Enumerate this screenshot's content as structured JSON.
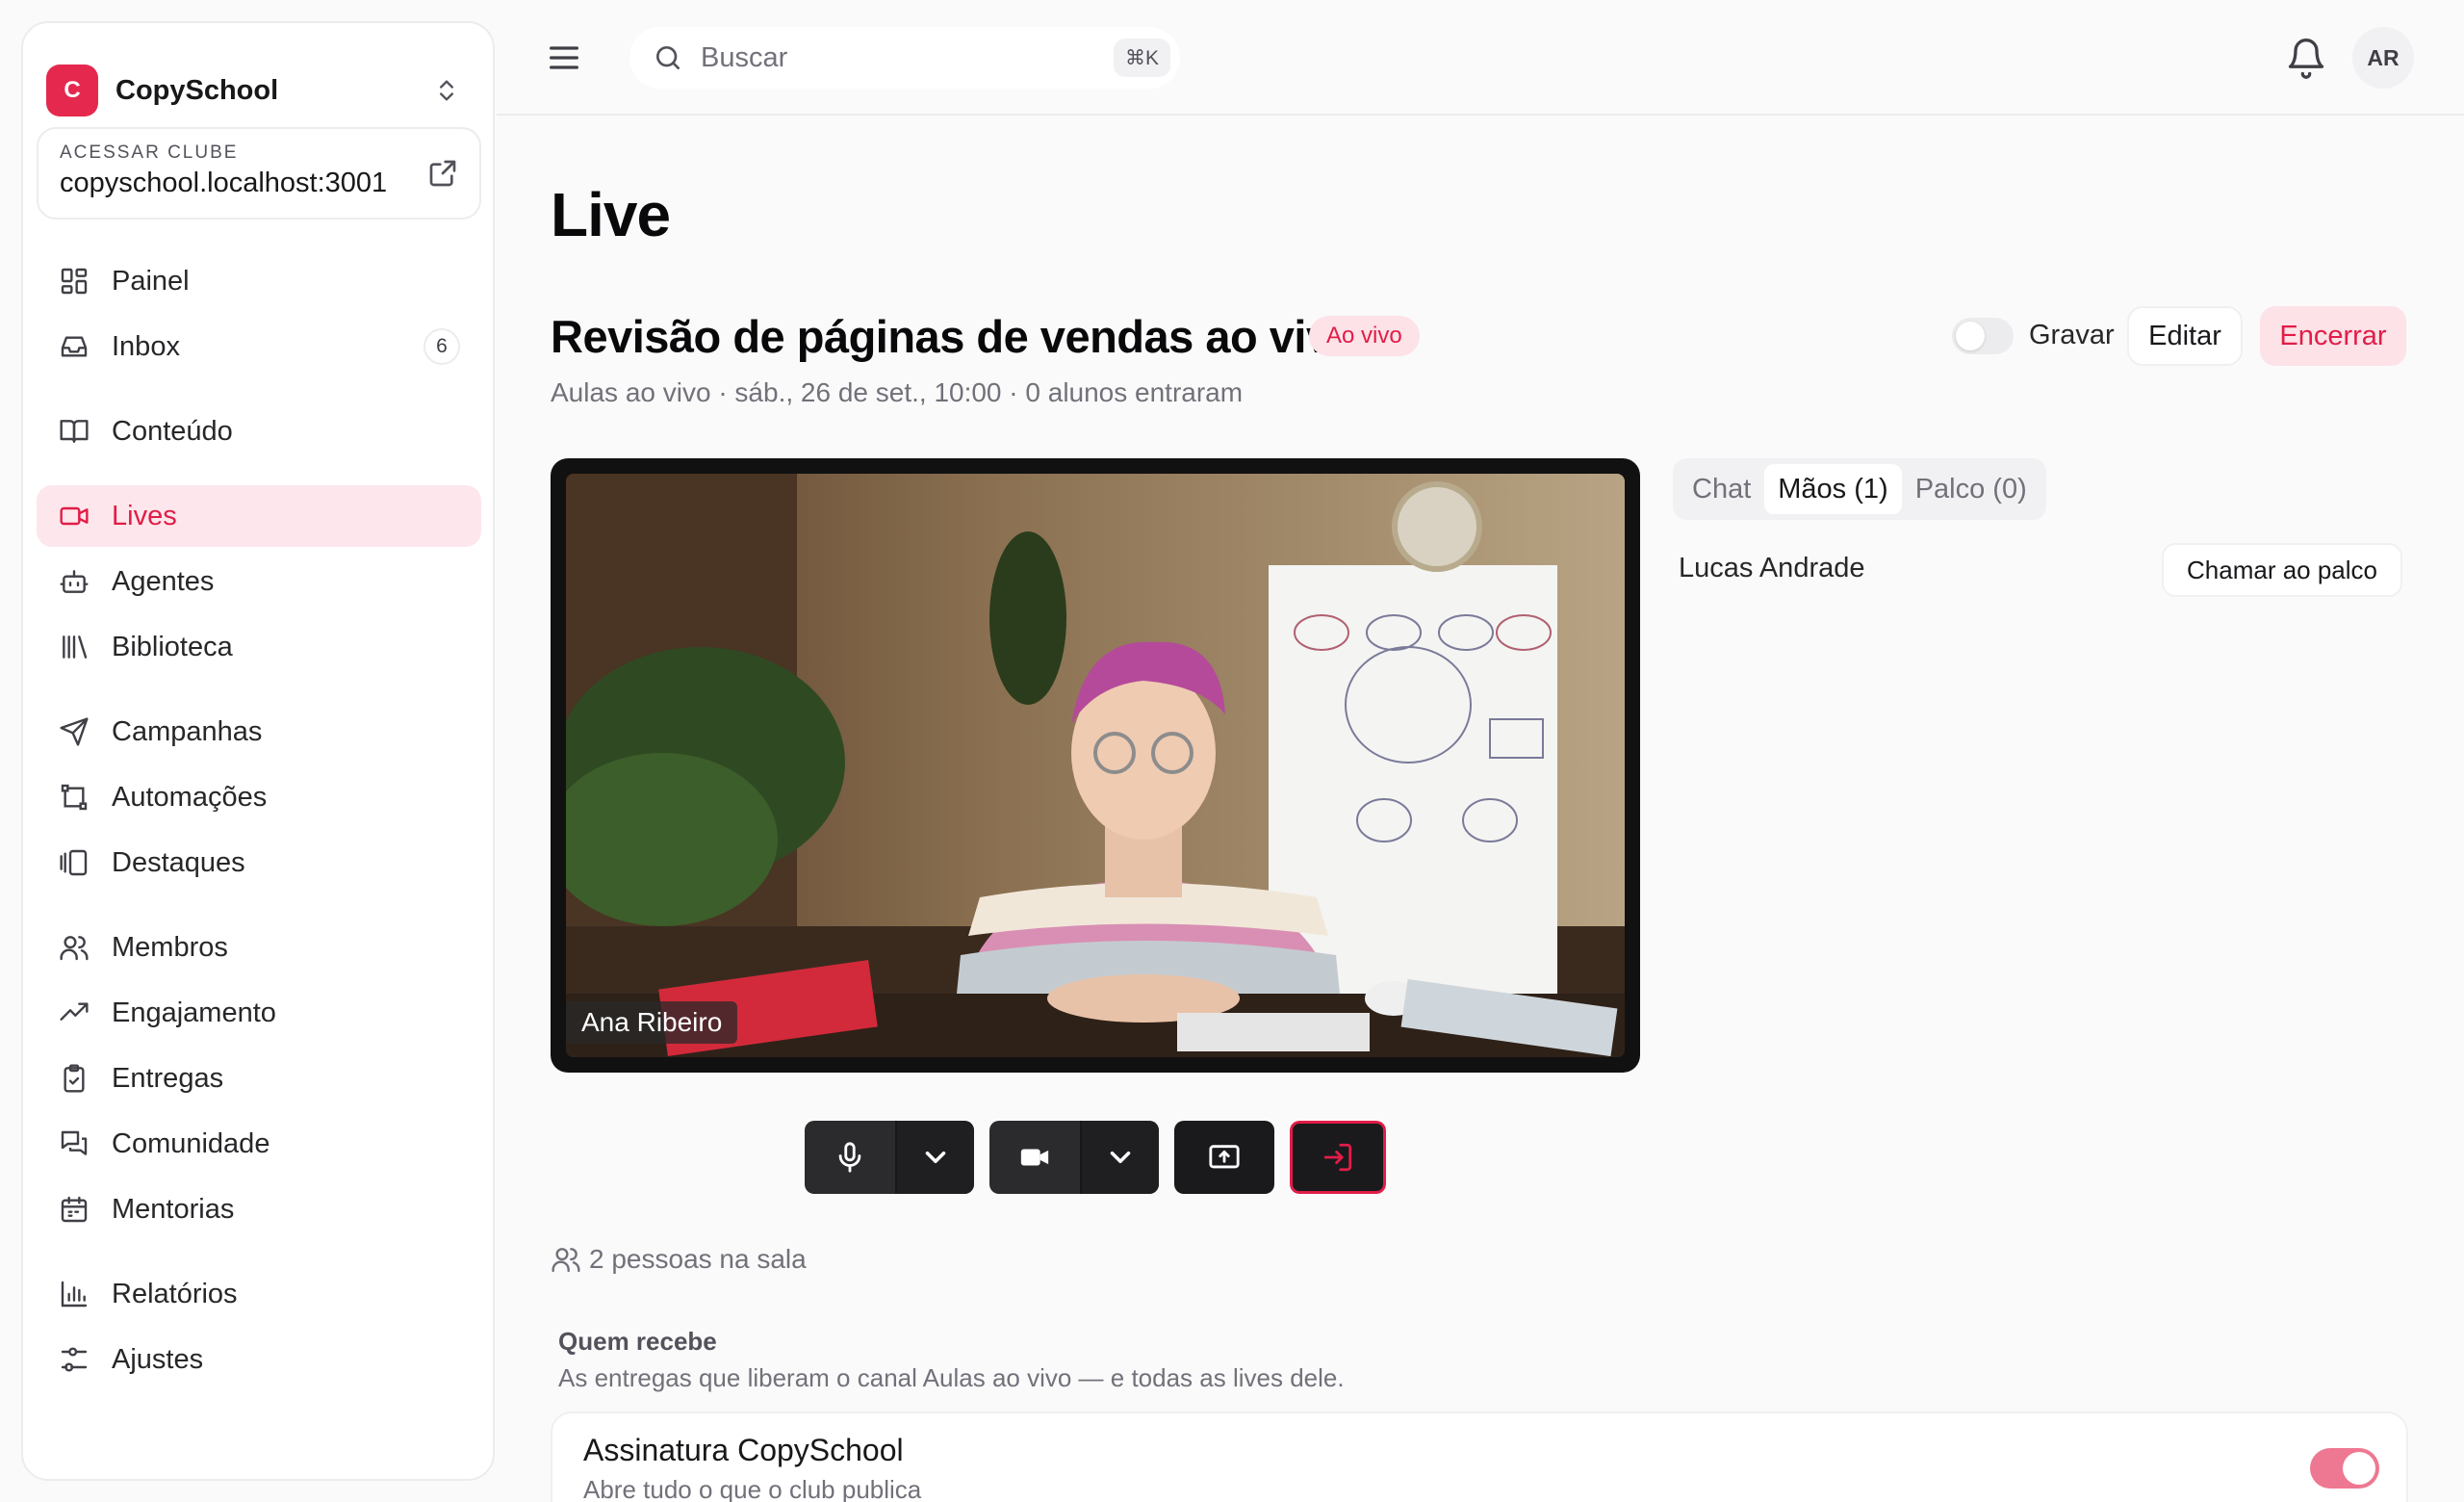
{
  "brand": {
    "initial": "C",
    "name": "CopySchool"
  },
  "club": {
    "label": "ACESSAR CLUBE",
    "url": "copyschool.localhost:3001"
  },
  "sidebar": {
    "items": [
      {
        "label": "Painel",
        "icon": "dashboard-icon"
      },
      {
        "label": "Inbox",
        "icon": "inbox-icon",
        "badge": "6"
      },
      {
        "label": "Conteúdo",
        "icon": "book-icon"
      },
      {
        "label": "Lives",
        "icon": "video-icon",
        "active": true
      },
      {
        "label": "Agentes",
        "icon": "bot-icon"
      },
      {
        "label": "Biblioteca",
        "icon": "library-icon"
      },
      {
        "label": "Campanhas",
        "icon": "send-icon"
      },
      {
        "label": "Automações",
        "icon": "workflow-icon"
      },
      {
        "label": "Destaques",
        "icon": "gallery-icon"
      },
      {
        "label": "Membros",
        "icon": "users-icon"
      },
      {
        "label": "Engajamento",
        "icon": "trending-icon"
      },
      {
        "label": "Entregas",
        "icon": "clipboard-check-icon"
      },
      {
        "label": "Comunidade",
        "icon": "messages-icon"
      },
      {
        "label": "Mentorias",
        "icon": "calendar-icon"
      },
      {
        "label": "Relatórios",
        "icon": "bar-chart-icon"
      },
      {
        "label": "Ajustes",
        "icon": "sliders-icon"
      }
    ]
  },
  "topbar": {
    "search_placeholder": "Buscar",
    "shortcut": "⌘K",
    "avatar_initials": "AR"
  },
  "main": {
    "page_title": "Live",
    "live_title": "Revisão de páginas de vendas ao vivo",
    "status_badge": "Ao vivo",
    "meta": "Aulas ao vivo · sáb., 26 de set., 10:00 · 0 alunos entraram",
    "record_label": "Gravar",
    "edit_label": "Editar",
    "end_label": "Encerrar",
    "presenter_name": "Ana Ribeiro",
    "people_count": "2 pessoas na sala",
    "who_title": "Quem recebe",
    "who_desc": "As entregas que liberam o canal Aulas ao vivo — e todas as lives dele.",
    "subscription": {
      "name": "Assinatura CopySchool",
      "desc": "Abre tudo o que o club publica",
      "enabled": true
    }
  },
  "panel": {
    "tabs": [
      {
        "label": "Chat"
      },
      {
        "label": "Mãos (1)",
        "active": true
      },
      {
        "label": "Palco (0)"
      }
    ],
    "hand_user": "Lucas Andrade",
    "stage_button": "Chamar ao palco"
  },
  "colors": {
    "accent": "#e11d48",
    "active_bg": "#fde7ec",
    "toggle_on": "#ee7891"
  }
}
